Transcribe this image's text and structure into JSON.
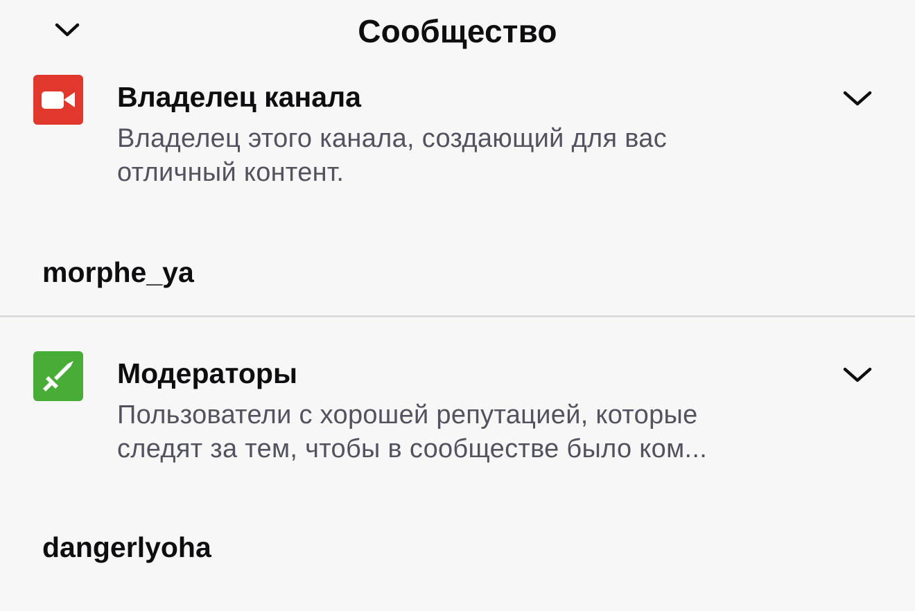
{
  "header": {
    "title": "Сообщество",
    "collapse_icon": "chevron-down-icon"
  },
  "roles": [
    {
      "name": "Владелец канала",
      "description_lines": [
        "Владелец этого канала, создающий для вас",
        "отличный контент."
      ],
      "icon": "video-camera-icon",
      "icon_color": "#e0382d",
      "members": [
        "morphe_ya"
      ]
    },
    {
      "name": "Модераторы",
      "description_lines": [
        "Пользователи с хорошей репутацией, которые",
        "следят за тем, чтобы в сообществе было ком..."
      ],
      "icon": "sword-icon",
      "icon_color": "#48ad36",
      "members": [
        "dangerlyoha"
      ]
    }
  ]
}
